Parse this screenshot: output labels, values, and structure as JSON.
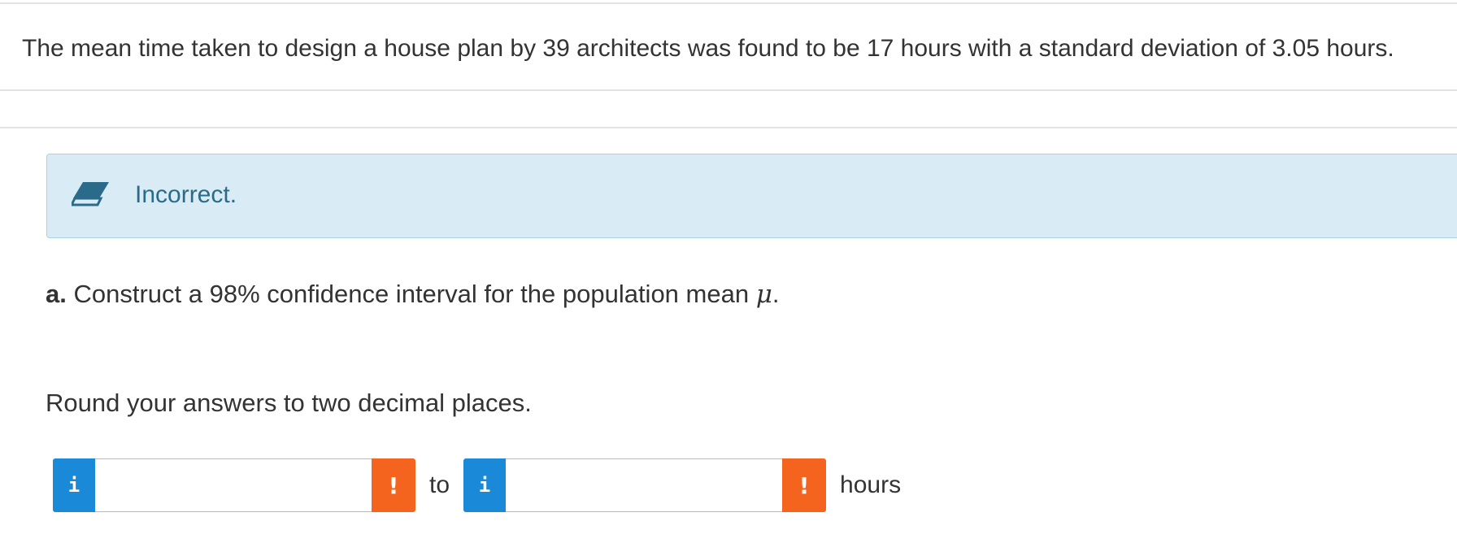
{
  "question": {
    "stem": "The mean time taken to design a house plan by 39 architects was found to be 17 hours with a standard deviation of 3.05 hours."
  },
  "feedback": {
    "icon": "eraser-icon",
    "message": "Incorrect.",
    "background_color": "#d9ecf5",
    "text_color": "#2a6b8a"
  },
  "part_a": {
    "letter": "a.",
    "prompt": " Construct a 98% confidence interval for the population mean ",
    "symbol": "μ",
    "end": "."
  },
  "instruction": "Round your answers to two decimal places.",
  "answer": {
    "info_label": "i",
    "warn_label": "!",
    "lower_value": "",
    "upper_value": "",
    "separator": "to",
    "unit": "hours",
    "info_color": "#1a8ad8",
    "warn_color": "#f5641f"
  }
}
